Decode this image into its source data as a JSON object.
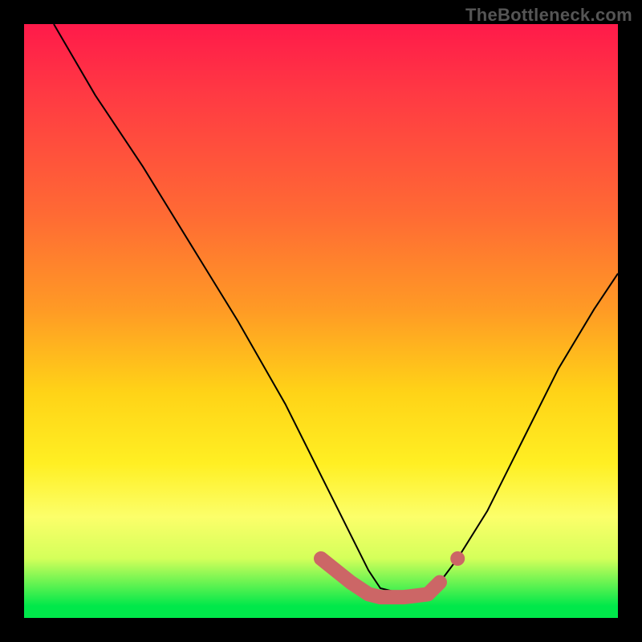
{
  "watermark": "TheBottleneck.com",
  "chart_data": {
    "type": "line",
    "title": "",
    "xlabel": "",
    "ylabel": "",
    "xlim": [
      0,
      100
    ],
    "ylim": [
      0,
      100
    ],
    "background_gradient": [
      {
        "pos": 0,
        "color": "#ff1a4a"
      },
      {
        "pos": 32,
        "color": "#ff6a34"
      },
      {
        "pos": 62,
        "color": "#ffd317"
      },
      {
        "pos": 83,
        "color": "#fcff6a"
      },
      {
        "pos": 100,
        "color": "#00e84a"
      }
    ],
    "series": [
      {
        "name": "thin-curve",
        "type": "line",
        "stroke": "#000000",
        "stroke_width": 2,
        "x": [
          5,
          12,
          20,
          28,
          36,
          44,
          50,
          55,
          58,
          60,
          64,
          68,
          70,
          73,
          78,
          84,
          90,
          96,
          100
        ],
        "y": [
          100,
          88,
          76,
          63,
          50,
          36,
          24,
          14,
          8,
          5,
          4,
          5,
          6,
          10,
          18,
          30,
          42,
          52,
          58
        ]
      },
      {
        "name": "thick-highlight",
        "type": "line",
        "stroke": "#cc6666",
        "stroke_width": 18,
        "x": [
          50,
          55,
          58,
          60,
          64,
          68,
          70
        ],
        "y": [
          10,
          6,
          4,
          3.5,
          3.5,
          4,
          6
        ]
      },
      {
        "name": "highlight-dot",
        "type": "scatter",
        "stroke": "#cc6666",
        "x": [
          73
        ],
        "y": [
          10
        ]
      }
    ]
  }
}
